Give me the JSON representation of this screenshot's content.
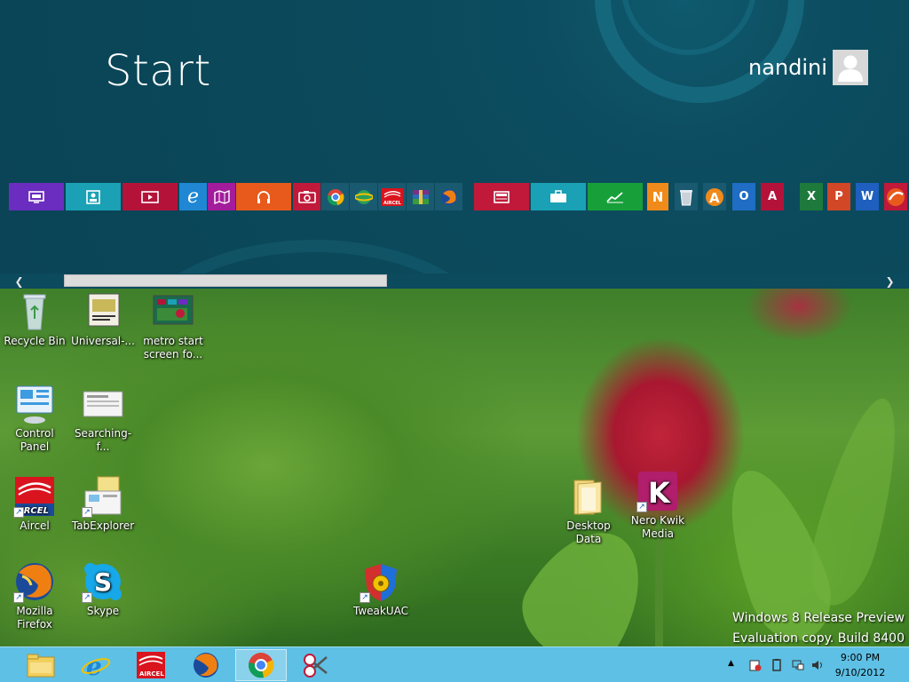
{
  "start": {
    "title": "Start",
    "user": {
      "name": "nandini"
    }
  },
  "tiles": [
    {
      "name": "tile-remote-desktop",
      "color": "#6b2dbf",
      "icon": "slideshow-icon"
    },
    {
      "name": "tile-people",
      "color": "#1aa1b5",
      "icon": "person-card-icon"
    },
    {
      "name": "tile-video",
      "color": "#b5123a",
      "icon": "video-icon"
    },
    {
      "name": "tile-internet-explorer",
      "color": "#1f87d4",
      "icon": "ie-icon"
    },
    {
      "name": "tile-maps",
      "color": "#a21c9b",
      "icon": "map-icon"
    },
    {
      "name": "tile-music",
      "color": "#e85a1c",
      "icon": "headphones-icon"
    },
    {
      "name": "tile-camera",
      "color": "#c0193a",
      "icon": "camera-icon"
    },
    {
      "name": "tile-chrome",
      "color": "#1a5a70",
      "icon": "chrome-icon"
    },
    {
      "name": "tile-globe-app",
      "color": "#1a5a70",
      "icon": "globe-icon"
    },
    {
      "name": "tile-aircel",
      "color": "#1a5a70",
      "icon": "aircel-icon"
    },
    {
      "name": "tile-winrar",
      "color": "#1a5a70",
      "icon": "winrar-icon"
    },
    {
      "name": "tile-firefox",
      "color": "#1a5a70",
      "icon": "firefox-icon"
    },
    {
      "name": "tile-news",
      "color": "#c0193a",
      "icon": "news-icon"
    },
    {
      "name": "tile-travel",
      "color": "#1aa1b5",
      "icon": "suitcase-icon"
    },
    {
      "name": "tile-finance",
      "color": "#17a03a",
      "icon": "chart-icon"
    },
    {
      "name": "tile-nero",
      "color": "#f08a1a",
      "icon": "nero-icon"
    },
    {
      "name": "tile-recycle-bin",
      "color": "#1a5a70",
      "icon": "trash-icon"
    },
    {
      "name": "tile-avast",
      "color": "#1a5a70",
      "icon": "avast-icon"
    },
    {
      "name": "tile-outlook",
      "color": "#1f6dc4",
      "icon": "outlook-icon"
    },
    {
      "name": "tile-access",
      "color": "#b5123a",
      "icon": "access-icon"
    },
    {
      "name": "tile-excel",
      "color": "#1e7a3c",
      "icon": "excel-icon"
    },
    {
      "name": "tile-powerpoint",
      "color": "#d24726",
      "icon": "powerpoint-icon"
    },
    {
      "name": "tile-word",
      "color": "#1f5fbf",
      "icon": "word-icon"
    },
    {
      "name": "tile-app-red",
      "color": "#c0193a",
      "icon": "app-icon"
    }
  ],
  "desktop_icons": [
    {
      "label": "Recycle Bin",
      "icon": "recycle-bin-icon"
    },
    {
      "label": "Universal-...",
      "icon": "universal-icon"
    },
    {
      "label": "metro start screen fo...",
      "icon": "image-file-icon"
    },
    {
      "label": "Control Panel",
      "icon": "control-panel-icon"
    },
    {
      "label": "Searching-f...",
      "icon": "document-icon"
    },
    {
      "label": "Aircel",
      "icon": "aircel-icon"
    },
    {
      "label": "TabExplorer",
      "icon": "folder-icon"
    },
    {
      "label": "Desktop Data",
      "icon": "folder-icon"
    },
    {
      "label": "Nero Kwik Media",
      "icon": "nero-kwik-icon"
    },
    {
      "label": "Mozilla Firefox",
      "icon": "firefox-icon"
    },
    {
      "label": "Skype",
      "icon": "skype-icon"
    },
    {
      "label": "TweakUAC",
      "icon": "tweakuac-icon"
    }
  ],
  "watermark": {
    "line1": "Windows 8 Release Preview",
    "line2": "Evaluation copy. Build 8400"
  },
  "taskbar": {
    "apps": [
      {
        "name": "taskbar-file-explorer",
        "icon": "folder-icon"
      },
      {
        "name": "taskbar-internet-explorer",
        "icon": "ie-icon"
      },
      {
        "name": "taskbar-aircel",
        "icon": "aircel-icon"
      },
      {
        "name": "taskbar-firefox",
        "icon": "firefox-icon"
      },
      {
        "name": "taskbar-chrome",
        "icon": "chrome-icon"
      },
      {
        "name": "taskbar-snipping-tool",
        "icon": "scissors-icon"
      }
    ],
    "clock": {
      "time": "9:00 PM",
      "date": "9/10/2012"
    }
  },
  "colors": {
    "start_bg": "#0a4456",
    "taskbar_bg": "#5ec0e5"
  }
}
